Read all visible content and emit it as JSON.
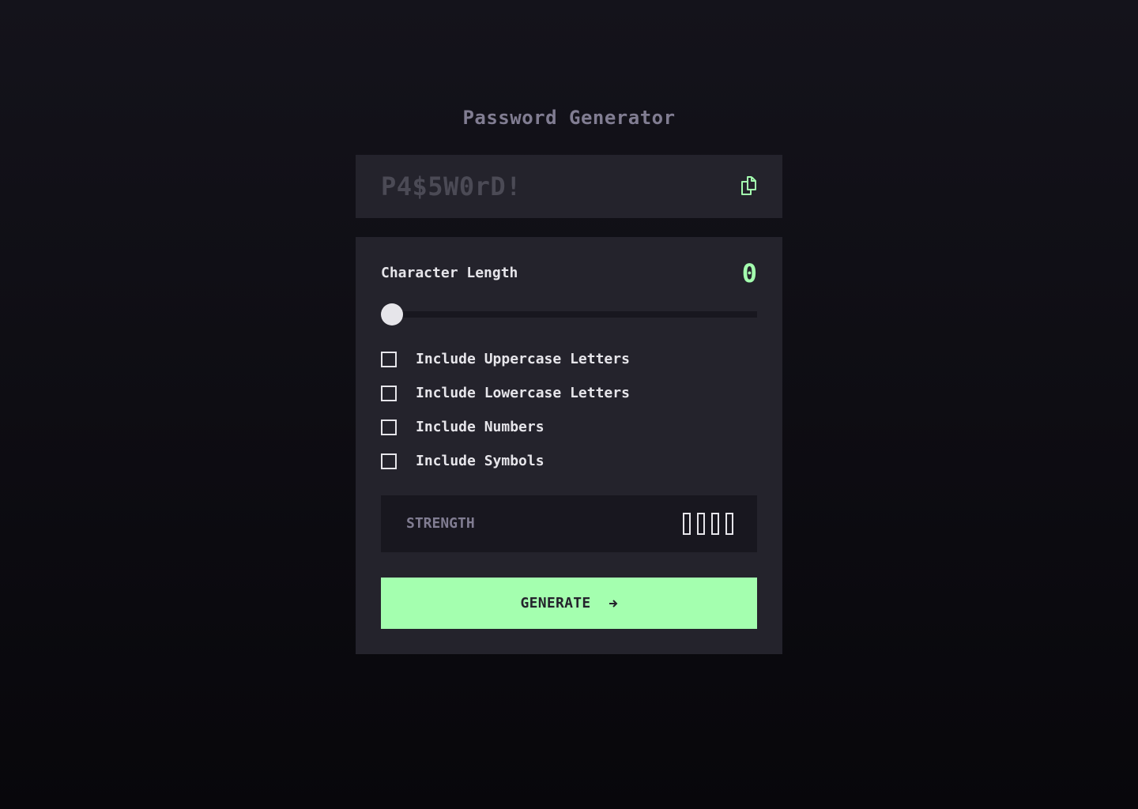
{
  "app": {
    "title": "Password Generator"
  },
  "output": {
    "password": "P4$5W0rD!",
    "copy_icon": "copy-icon"
  },
  "length": {
    "label": "Character Length",
    "value": "0",
    "slider_fraction": 0
  },
  "options": [
    {
      "label": "Include Uppercase Letters",
      "checked": false
    },
    {
      "label": "Include Lowercase Letters",
      "checked": false
    },
    {
      "label": "Include Numbers",
      "checked": false
    },
    {
      "label": "Include Symbols",
      "checked": false
    }
  ],
  "strength": {
    "label": "STRENGTH",
    "level": 0,
    "max_level": 4
  },
  "generate": {
    "label": "GENERATE",
    "icon": "arrow-right-icon"
  },
  "colors": {
    "accent": "#a4ffaf",
    "panel": "#24232c",
    "inset": "#18171f",
    "muted": "#817d92",
    "text": "#e6e5ea"
  }
}
